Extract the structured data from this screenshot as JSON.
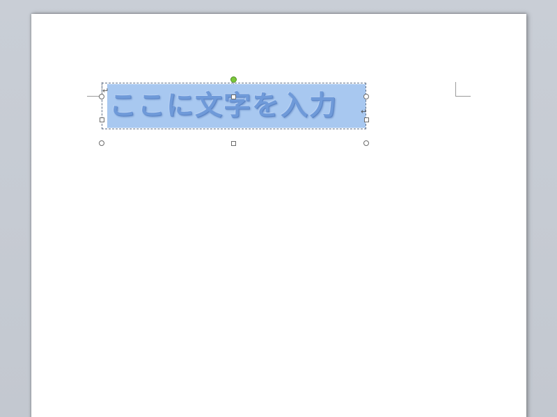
{
  "document": {
    "wordart_text": "ここに文字を入力",
    "paragraph_mark": "↵"
  },
  "colors": {
    "workspace": "#c6cbd3",
    "page": "#ffffff",
    "wordart_fill": "#6f9ad9",
    "selection_highlight": "#a8c8f0",
    "rotate_handle": "#7cc83a"
  },
  "icons": {
    "rotate_handle": "rotation-handle-icon",
    "resize_handle": "resize-handle-icon"
  }
}
